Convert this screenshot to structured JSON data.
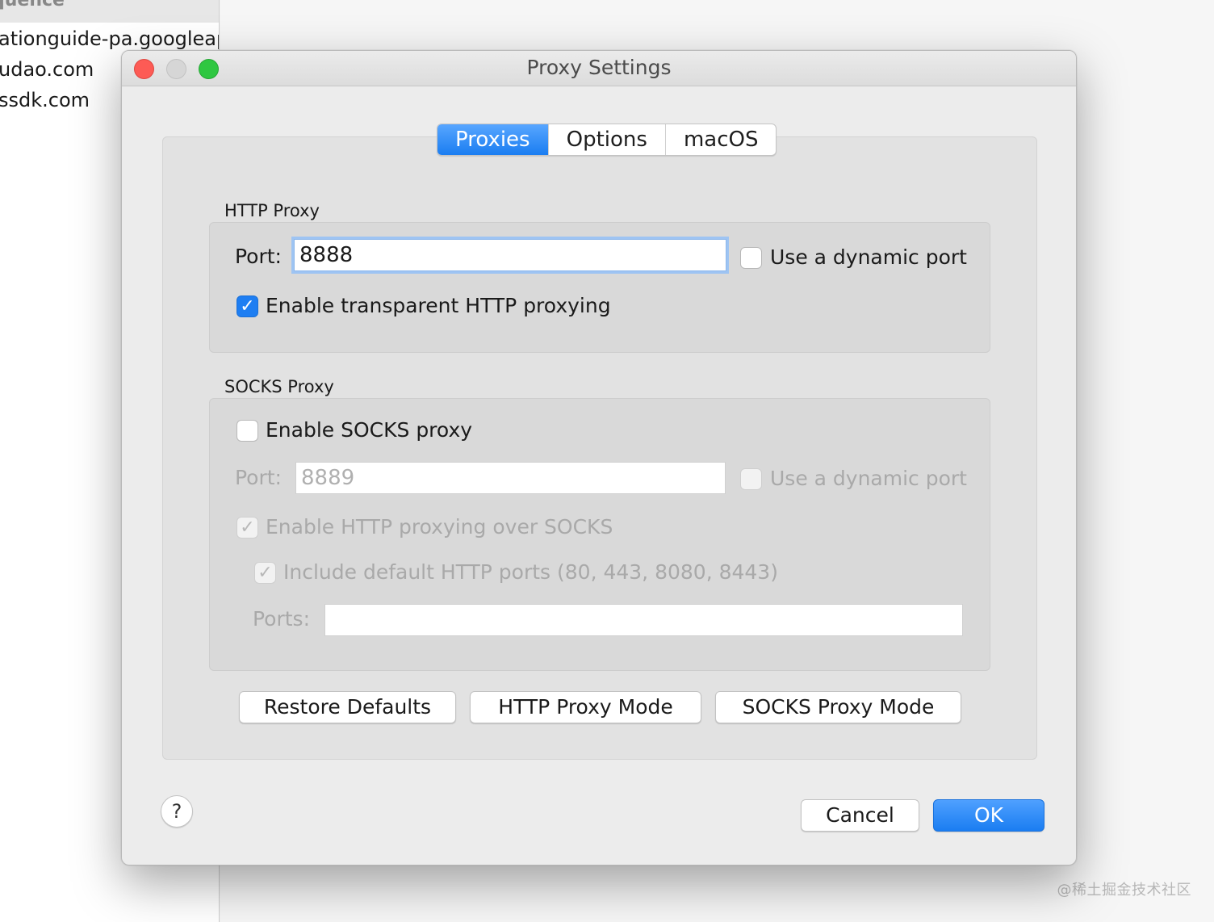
{
  "background": {
    "header_text": "quence",
    "list_items": [
      "ationguide-pa.googleapi",
      "udao.com",
      "ssdk.com"
    ],
    "watermark": "@稀土掘金技术社区"
  },
  "window": {
    "title": "Proxy Settings",
    "tabs": [
      {
        "label": "Proxies",
        "active": true
      },
      {
        "label": "Options",
        "active": false
      },
      {
        "label": "macOS",
        "active": false
      }
    ]
  },
  "http_proxy": {
    "title": "HTTP Proxy",
    "port_label": "Port:",
    "port_value": "8888",
    "dynamic_port_label": "Use a dynamic port",
    "dynamic_port_checked": false,
    "transparent_label": "Enable transparent HTTP proxying",
    "transparent_checked": true
  },
  "socks_proxy": {
    "title": "SOCKS Proxy",
    "enable_label": "Enable SOCKS proxy",
    "enable_checked": false,
    "port_label": "Port:",
    "port_placeholder": "8889",
    "dynamic_port_label": "Use a dynamic port",
    "http_over_socks_label": "Enable HTTP proxying over SOCKS",
    "http_over_socks_checked": true,
    "include_defaults_label": "Include default HTTP ports (80, 443, 8080, 8443)",
    "include_defaults_checked": true,
    "ports_label": "Ports:",
    "ports_value": ""
  },
  "buttons": {
    "restore_defaults": "Restore Defaults",
    "http_mode": "HTTP Proxy Mode",
    "socks_mode": "SOCKS Proxy Mode",
    "cancel": "Cancel",
    "ok": "OK",
    "help": "?"
  },
  "icons": {
    "check": "check-icon",
    "help": "question-icon"
  },
  "colors": {
    "accent": "#1e7ef2",
    "close": "#fd5b55",
    "maximize": "#2fc741"
  }
}
